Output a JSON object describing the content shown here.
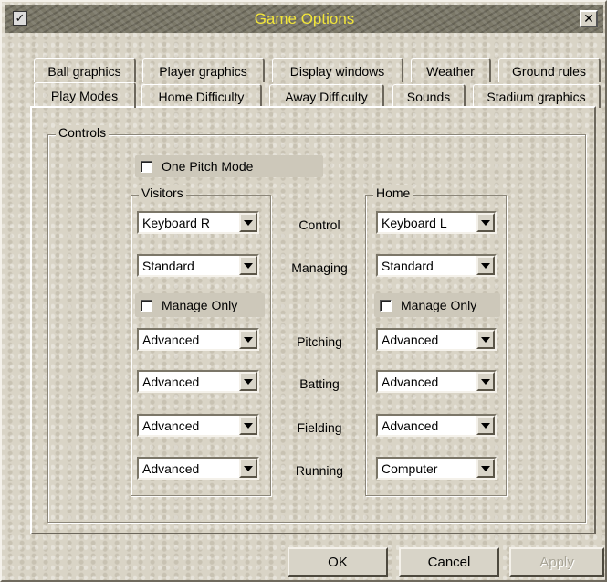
{
  "window": {
    "title": "Game Options"
  },
  "tabs_row1": [
    "Ball graphics",
    "Player graphics",
    "Display windows",
    "Weather",
    "Ground rules"
  ],
  "tabs_row2": [
    "Play Modes",
    "Home Difficulty",
    "Away Difficulty",
    "Sounds",
    "Stadium graphics"
  ],
  "controls": {
    "group_label": "Controls",
    "one_pitch_mode": {
      "label": "One Pitch Mode",
      "checked": false
    },
    "visitors": {
      "label": "Visitors",
      "control": "Keyboard R",
      "managing": "Standard",
      "manage_only": {
        "label": "Manage Only",
        "checked": false
      },
      "pitching": "Advanced",
      "batting": "Advanced",
      "fielding": "Advanced",
      "running": "Advanced"
    },
    "home": {
      "label": "Home",
      "control": "Keyboard L",
      "managing": "Standard",
      "manage_only": {
        "label": "Manage Only",
        "checked": false
      },
      "pitching": "Advanced",
      "batting": "Advanced",
      "fielding": "Advanced",
      "running": "Computer"
    },
    "row_labels": {
      "control": "Control",
      "managing": "Managing",
      "pitching": "Pitching",
      "batting": "Batting",
      "fielding": "Fielding",
      "running": "Running"
    }
  },
  "buttons": {
    "ok": "OK",
    "cancel": "Cancel",
    "apply": "Apply"
  }
}
